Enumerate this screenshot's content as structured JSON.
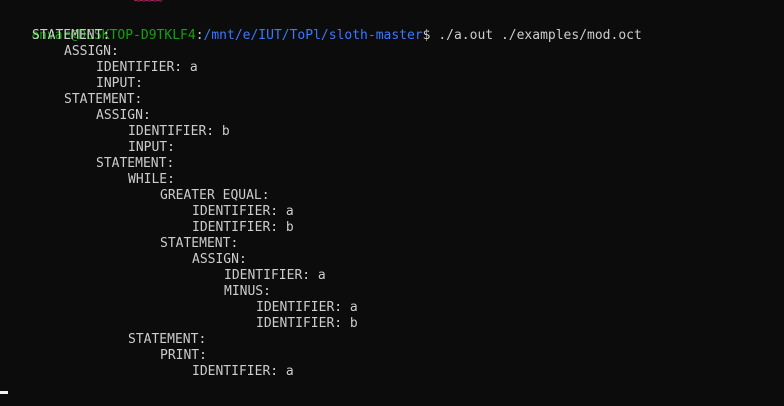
{
  "theme": {
    "background": "#0c0c0c",
    "foreground": "#cccccc",
    "user_color": "#13a10e",
    "path_color": "#3b78ff",
    "squiggle_color": "#c0286b"
  },
  "prompt": {
    "user_host": "anvar@DESKTOP-D9TKLF4",
    "separator": ":",
    "path": "/mnt/e/IUT/ToPl/sloth-master",
    "symbol": "$",
    "command": " ./a.out ./examples/mod.oct"
  },
  "squiggle": "^~~~~~",
  "output": [
    {
      "depth": 1,
      "text": "STATEMENT:"
    },
    {
      "depth": 2,
      "text": "ASSIGN:"
    },
    {
      "depth": 3,
      "text": "IDENTIFIER: a"
    },
    {
      "depth": 3,
      "text": "INPUT:"
    },
    {
      "depth": 2,
      "text": "STATEMENT:"
    },
    {
      "depth": 3,
      "text": "ASSIGN:"
    },
    {
      "depth": 4,
      "text": "IDENTIFIER: b"
    },
    {
      "depth": 4,
      "text": "INPUT:"
    },
    {
      "depth": 3,
      "text": "STATEMENT:"
    },
    {
      "depth": 4,
      "text": "WHILE:"
    },
    {
      "depth": 5,
      "text": "GREATER EQUAL:"
    },
    {
      "depth": 6,
      "text": "IDENTIFIER: a"
    },
    {
      "depth": 6,
      "text": "IDENTIFIER: b"
    },
    {
      "depth": 5,
      "text": "STATEMENT:"
    },
    {
      "depth": 6,
      "text": "ASSIGN:"
    },
    {
      "depth": 7,
      "text": "IDENTIFIER: a"
    },
    {
      "depth": 7,
      "text": "MINUS:"
    },
    {
      "depth": 8,
      "text": "IDENTIFIER: a"
    },
    {
      "depth": 8,
      "text": "IDENTIFIER: b"
    },
    {
      "depth": 4,
      "text": "STATEMENT:"
    },
    {
      "depth": 5,
      "text": "PRINT:"
    },
    {
      "depth": 6,
      "text": "IDENTIFIER: a"
    }
  ]
}
